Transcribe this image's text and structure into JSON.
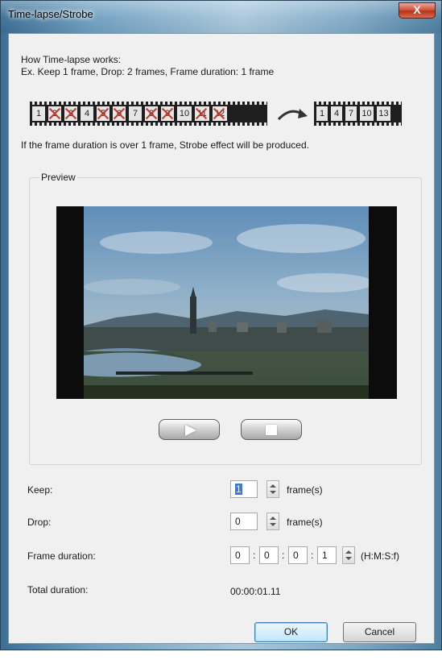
{
  "window": {
    "title": "Time-lapse/Strobe",
    "close_glyph": "X"
  },
  "intro": {
    "heading": "How Time-lapse works:",
    "example": "Ex. Keep 1 frame, Drop: 2 frames, Frame duration: 1 frame",
    "note": "If the frame duration is over 1 frame, Strobe effect will be produced."
  },
  "diagram": {
    "source_frames": [
      {
        "n": "1",
        "dropped": false
      },
      {
        "n": "2",
        "dropped": true
      },
      {
        "n": "3",
        "dropped": true
      },
      {
        "n": "4",
        "dropped": false
      },
      {
        "n": "5",
        "dropped": true
      },
      {
        "n": "6",
        "dropped": true
      },
      {
        "n": "7",
        "dropped": false
      },
      {
        "n": "8",
        "dropped": true
      },
      {
        "n": "9",
        "dropped": true
      },
      {
        "n": "10",
        "dropped": false
      },
      {
        "n": "11",
        "dropped": true
      },
      {
        "n": "12",
        "dropped": true
      }
    ],
    "result_frames": [
      "1",
      "4",
      "7",
      "10",
      "13"
    ],
    "arrow_icon": "curved-arrow-right-icon"
  },
  "preview": {
    "group_label": "Preview",
    "play_icon": "play-icon",
    "stop_icon": "stop-icon"
  },
  "settings": {
    "keep_label": "Keep:",
    "keep_value": "1",
    "keep_unit": "frame(s)",
    "drop_label": "Drop:",
    "drop_value": "0",
    "drop_unit": "frame(s)",
    "frame_duration_label": "Frame duration:",
    "frame_duration": {
      "h": "0",
      "m": "0",
      "s": "0",
      "f": "1"
    },
    "frame_duration_format": "(H:M:S:f)",
    "total_duration_label": "Total duration:",
    "total_duration_value": "00:00:01.11"
  },
  "buttons": {
    "ok": "OK",
    "cancel": "Cancel"
  },
  "colors": {
    "accent": "#3c7fb1",
    "drop_mark": "#c0392b",
    "selection": "#3a7bd5"
  }
}
